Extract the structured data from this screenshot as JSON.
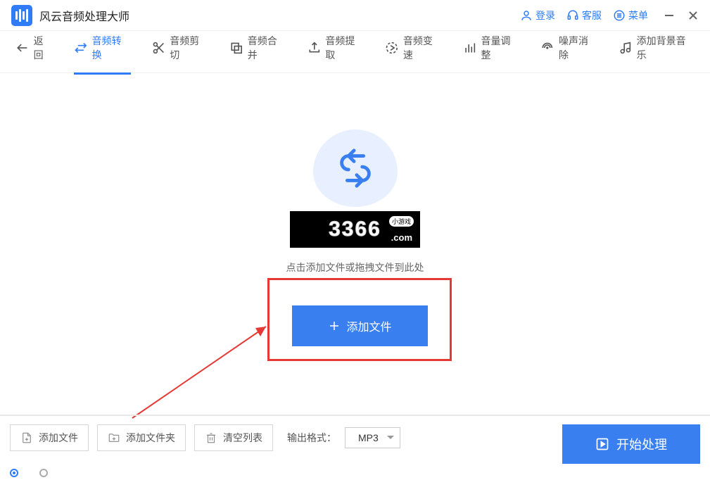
{
  "app": {
    "title": "风云音频处理大师"
  },
  "header": {
    "login": "登录",
    "support": "客服",
    "menu": "菜单"
  },
  "toolbar": {
    "back": "返回",
    "items": [
      {
        "label": "音频转换"
      },
      {
        "label": "音频剪切"
      },
      {
        "label": "音频合并"
      },
      {
        "label": "音频提取"
      },
      {
        "label": "音频变速"
      },
      {
        "label": "音量调整"
      },
      {
        "label": "噪声消除"
      },
      {
        "label": "添加背景音乐"
      }
    ]
  },
  "main": {
    "hint": "点击添加文件或拖拽文件到此处",
    "add_button": "添加文件"
  },
  "overlay": {
    "number": "3366",
    "tag": "小游戏",
    "suffix": ".com"
  },
  "bottom": {
    "add_file": "添加文件",
    "add_folder": "添加文件夹",
    "clear_list": "清空列表",
    "output_label": "输出格式：",
    "output_value": "MP3",
    "start": "开始处理"
  }
}
